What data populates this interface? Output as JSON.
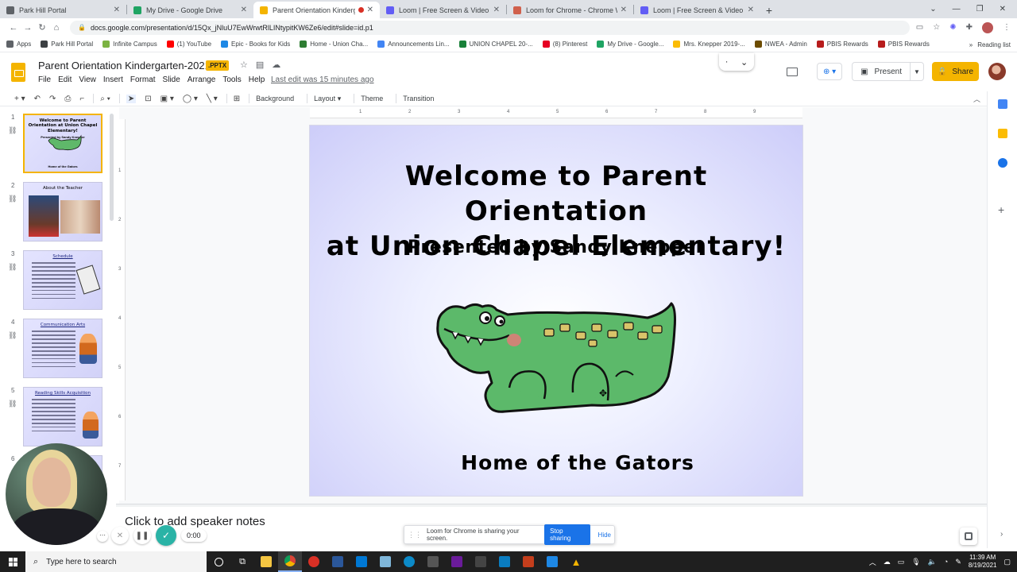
{
  "browser": {
    "tabs": [
      {
        "title": "Park Hill Portal",
        "color": "#5f6368",
        "active": false
      },
      {
        "title": "My Drive - Google Drive",
        "color": "#1fa463",
        "active": false
      },
      {
        "title": "Parent Orientation Kindergarten",
        "color": "#f4b400",
        "active": true
      },
      {
        "title": "Loom | Free Screen & Video Rec",
        "color": "#625df5",
        "active": false
      },
      {
        "title": "Loom for Chrome - Chrome Web",
        "color": "#d0604c",
        "active": false
      },
      {
        "title": "Loom | Free Screen & Video Rec",
        "color": "#625df5",
        "active": false
      }
    ],
    "new_tab": "+",
    "url": "docs.google.com/presentation/d/15Qx_jNluU7EwWrwtRlLINtypitKW6Ze6/edit#slide=id.p1",
    "bookmarks": [
      {
        "label": "Apps",
        "color": "#5f6368"
      },
      {
        "label": "Park Hill Portal",
        "color": "#3c4043"
      },
      {
        "label": "Infinite Campus",
        "color": "#7cb342"
      },
      {
        "label": "(1) YouTube",
        "color": "#ff0000"
      },
      {
        "label": "Epic - Books for Kids",
        "color": "#1e88e5"
      },
      {
        "label": "Home - Union Cha...",
        "color": "#2e7d32"
      },
      {
        "label": "Announcements Lin...",
        "color": "#4285f4"
      },
      {
        "label": "UNION CHAPEL 20-...",
        "color": "#188038"
      },
      {
        "label": "(8) Pinterest",
        "color": "#e60023"
      },
      {
        "label": "My Drive - Google...",
        "color": "#1fa463"
      },
      {
        "label": "Mrs. Knepper 2019-...",
        "color": "#fbbc04"
      },
      {
        "label": "NWEA - Admin",
        "color": "#6d4c00"
      },
      {
        "label": "PBIS Rewards",
        "color": "#b71c1c"
      },
      {
        "label": "PBIS Rewards",
        "color": "#b71c1c"
      }
    ],
    "reading_list": "Reading list",
    "more_bookmarks": "»"
  },
  "docs": {
    "title": "Parent Orientation Kindergarten-2021",
    "badge": ".PPTX",
    "menu": [
      "File",
      "Edit",
      "View",
      "Insert",
      "Format",
      "Slide",
      "Arrange",
      "Tools",
      "Help"
    ],
    "last_edit": "Last edit was 15 minutes ago",
    "present_label": "Present",
    "share_label": "Share",
    "toolbar": {
      "background": "Background",
      "layout": "Layout",
      "theme": "Theme",
      "transition": "Transition"
    },
    "speaker_notes_placeholder": "Click to add speaker notes"
  },
  "filmstrip": [
    {
      "num": "1",
      "title": "Welcome to Parent Orientation at Union Chapel Elementary!",
      "sub": "Presented by Sandy Knepper",
      "foot": "Home of the Gators"
    },
    {
      "num": "2",
      "title": "About the Teacher"
    },
    {
      "num": "3",
      "title": "Schedule"
    },
    {
      "num": "4",
      "title": "Communication Arts"
    },
    {
      "num": "5",
      "title": "Reading Skills Acquisition"
    },
    {
      "num": "6"
    }
  ],
  "ruler": {
    "h": [
      "1",
      "2",
      "3",
      "4",
      "5",
      "6",
      "7",
      "8",
      "9"
    ],
    "v": [
      "1",
      "2",
      "3",
      "4",
      "5",
      "6",
      "7"
    ]
  },
  "slide": {
    "title_line1": "Welcome to Parent Orientation",
    "title_line2": "at Union Chapel Elementary!",
    "subtitle": "Presented by Sandy Knepper",
    "footer": "Home of the Gators",
    "background_color": "#cdcdf9"
  },
  "loom": {
    "timer": "0:00",
    "sharing_text": "Loom for Chrome is sharing your screen.",
    "stop_sharing": "Stop sharing",
    "hide": "Hide"
  },
  "taskbar": {
    "search_placeholder": "Type here to search",
    "time": "11:39 AM",
    "date": "8/19/2021"
  }
}
